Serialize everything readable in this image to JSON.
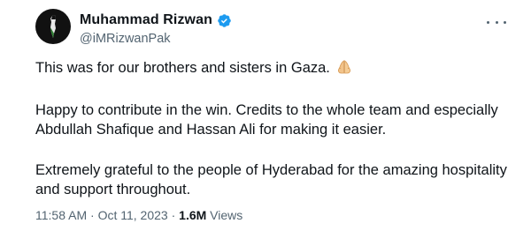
{
  "author": {
    "name": "Muhammad Rizwan",
    "handle": "@iMRizwanPak",
    "verified_icon": "verified-badge-icon",
    "verified_color": "#1d9bf0"
  },
  "tweet": {
    "line1": "This was for our brothers and sisters in Gaza.",
    "line1_emoji": "folded-hands-icon",
    "paragraph2": "Happy to contribute in the win. Credits to the whole team and especially Abdullah Shafique and Hassan Ali for making it easier.",
    "paragraph3": "Extremely grateful to the people of Hyderabad for the amazing hospitality and support throughout."
  },
  "meta": {
    "time": "11:58 AM",
    "separator1": " · ",
    "date": "Oct 11, 2023",
    "separator2": " · ",
    "views_count": "1.6M",
    "views_label": " Views"
  },
  "colors": {
    "text": "#0f1419",
    "secondary": "#536471",
    "background": "#ffffff"
  }
}
